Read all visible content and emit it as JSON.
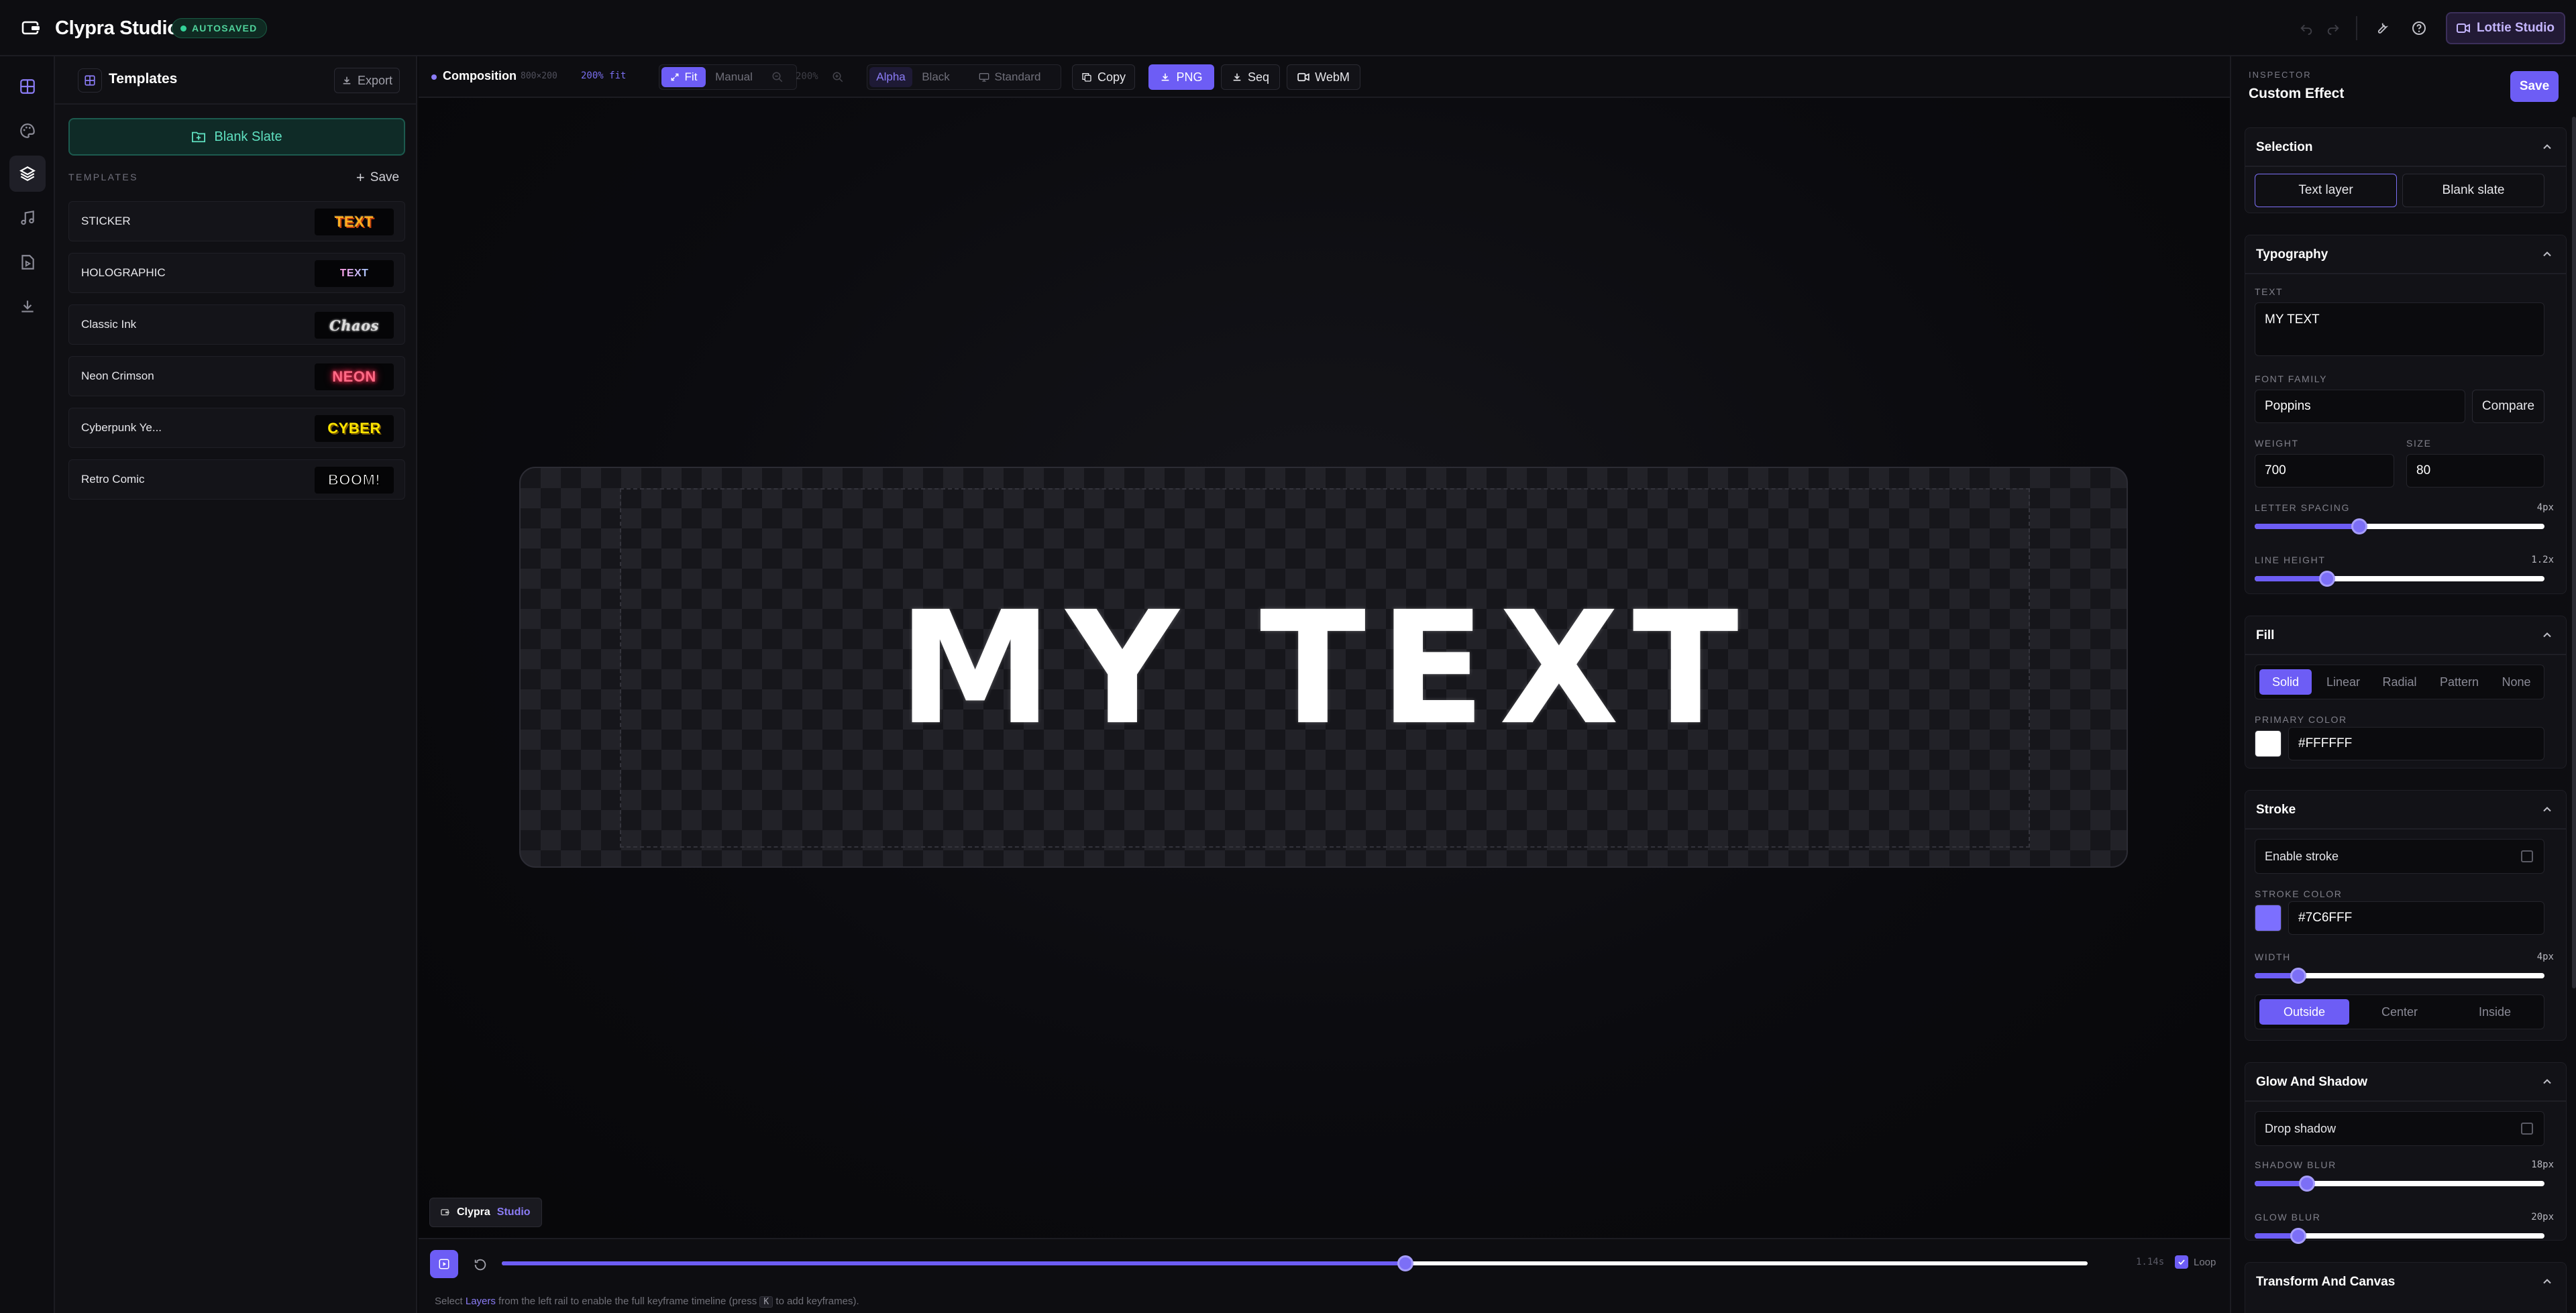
{
  "app": {
    "title": "Clypra Studio",
    "status": "AUTOSAVED",
    "studio_button": "Lottie Studio"
  },
  "templates": {
    "title": "Templates",
    "export_label": "Export",
    "blank_slate": "Blank Slate",
    "section_label": "TEMPLATES",
    "save_label": "Save",
    "items": [
      {
        "name": "STICKER",
        "preview": "TEXT",
        "preview_color": "#ffb020"
      },
      {
        "name": "HOLOGRAPHIC",
        "preview": "TEXT",
        "preview_color": "#f0a8ff"
      },
      {
        "name": "Classic Ink",
        "preview": "Chaos",
        "preview_color": "#dcdcdc"
      },
      {
        "name": "Neon Crimson",
        "preview": "NEON",
        "preview_color": "#ff5a7a"
      },
      {
        "name": "Cyberpunk Ye...",
        "preview": "CYBER",
        "preview_color": "#ffe600"
      },
      {
        "name": "Retro Comic",
        "preview": "BOOM!",
        "preview_color": "#ffffff"
      }
    ]
  },
  "toolbar": {
    "composition": "Composition",
    "dimensions": "800×200",
    "zoom_fit": "200% fit",
    "fit_label": "Fit",
    "manual_label": "Manual",
    "zoom_value": "200%",
    "alpha_label": "Alpha",
    "black_label": "Black",
    "standard_label": "Standard",
    "copy_label": "Copy",
    "png_label": "PNG",
    "seq_label": "Seq",
    "webm_label": "WebM"
  },
  "canvas": {
    "text": "MY TEXT",
    "watermark_brand": "Clypra",
    "watermark_accent": "Studio"
  },
  "timeline": {
    "time": "1.14s",
    "loop_label": "Loop",
    "progress": 0.57,
    "hint_pre": "Select ",
    "hint_link": "Layers",
    "hint_mid": " from the left rail to enable the full keyframe timeline (press ",
    "hint_key": "K",
    "hint_post": " to add keyframes)."
  },
  "inspector": {
    "label": "INSPECTOR",
    "title": "Custom Effect",
    "save_label": "Save",
    "selection": {
      "title": "Selection",
      "text_layer": "Text layer",
      "blank_slate": "Blank slate"
    },
    "typography": {
      "title": "Typography",
      "text_label": "TEXT",
      "text_value": "MY TEXT",
      "font_label": "FONT FAMILY",
      "font_value": "Poppins",
      "compare_label": "Compare",
      "weight_label": "WEIGHT",
      "weight_value": "700",
      "size_label": "SIZE",
      "size_value": "80",
      "letter_label": "LETTER SPACING",
      "letter_value": "4px",
      "letter_fraction": 0.36,
      "line_label": "LINE HEIGHT",
      "line_value": "1.2x",
      "line_fraction": 0.25
    },
    "fill": {
      "title": "Fill",
      "modes": [
        "Solid",
        "Linear",
        "Radial",
        "Pattern",
        "None"
      ],
      "color_label": "PRIMARY COLOR",
      "color_value": "#FFFFFF"
    },
    "stroke": {
      "title": "Stroke",
      "enable_label": "Enable stroke",
      "color_label": "STROKE COLOR",
      "color_value": "#7C6FFF",
      "width_label": "WIDTH",
      "width_value": "4px",
      "width_fraction": 0.15,
      "positions": [
        "Outside",
        "Center",
        "Inside"
      ]
    },
    "glow": {
      "title": "Glow And Shadow",
      "drop_label": "Drop shadow",
      "shadow_label": "SHADOW BLUR",
      "shadow_value": "18px",
      "shadow_fraction": 0.18,
      "glow_label": "GLOW BLUR",
      "glow_value": "20px",
      "glow_fraction": 0.15
    },
    "transform": {
      "title": "Transform And Canvas"
    }
  },
  "colors": {
    "accent": "#6d5df5",
    "success": "#34d399",
    "stroke_swatch": "#7c6fff"
  }
}
